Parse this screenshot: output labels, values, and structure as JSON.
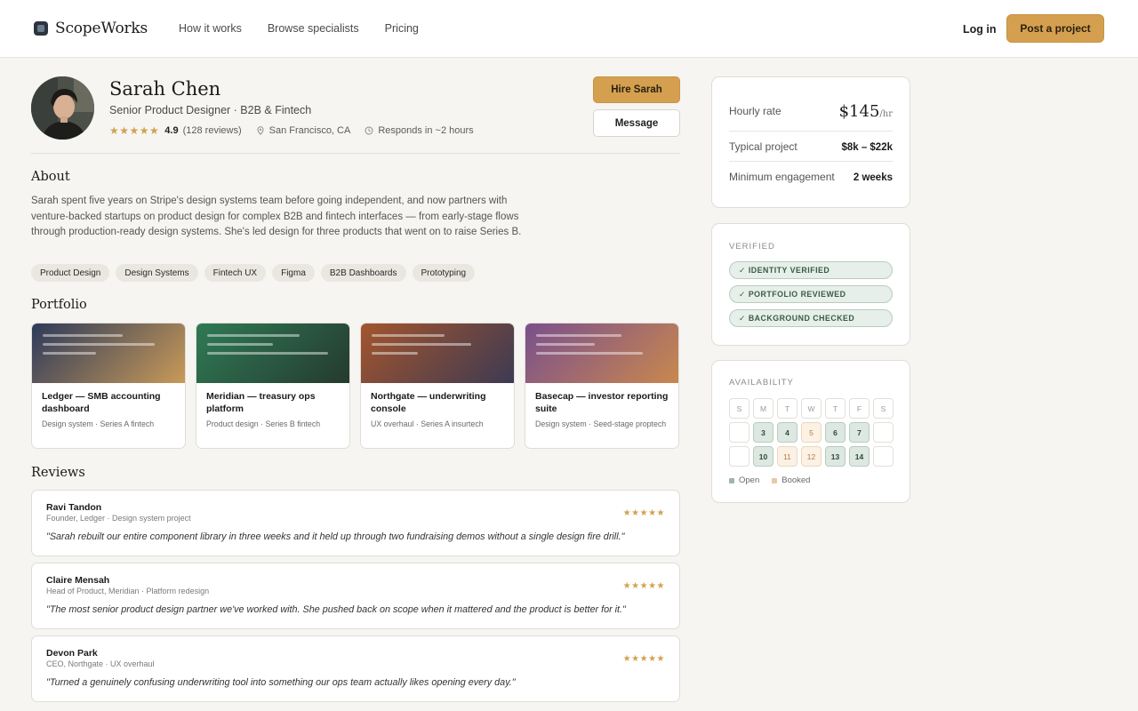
{
  "header": {
    "brand": "ScopeWorks",
    "nav": [
      "How it works",
      "Browse specialists",
      "Pricing"
    ],
    "login": "Log in",
    "post_project": "Post a project"
  },
  "profile": {
    "name": "Sarah Chen",
    "title": "Senior Product Designer · B2B & Fintech",
    "stars": "★★★★★",
    "rating": "4.9",
    "reviews_count": "(128 reviews)",
    "location": "San Francisco, CA",
    "response": "Responds in ~2 hours",
    "hire_label": "Hire Sarah",
    "message_label": "Message"
  },
  "about": {
    "heading": "About",
    "text": "Sarah spent five years on Stripe's design systems team before going independent, and now partners with venture-backed startups on product design for complex B2B and fintech interfaces — from early-stage flows through production-ready design systems. She's led design for three products that went on to raise Series B.",
    "tags": [
      "Product Design",
      "Design Systems",
      "Fintech UX",
      "Figma",
      "B2B Dashboards",
      "Prototyping"
    ]
  },
  "portfolio": {
    "heading": "Portfolio",
    "items": [
      {
        "title": "Ledger — SMB accounting dashboard",
        "subtitle": "Design system · Series A fintech",
        "color_a": "#2d3a5a",
        "color_b": "#c99a58"
      },
      {
        "title": "Meridian — treasury ops platform",
        "subtitle": "Product design · Series B fintech",
        "color_a": "#2f7a55",
        "color_b": "#253a2e"
      },
      {
        "title": "Northgate — underwriting console",
        "subtitle": "UX overhaul · Series A insurtech",
        "color_a": "#a3552e",
        "color_b": "#3d3a52"
      },
      {
        "title": "Basecap — investor reporting suite",
        "subtitle": "Design system · Seed-stage proptech",
        "color_a": "#7a4f8c",
        "color_b": "#c9884e"
      }
    ]
  },
  "reviews": {
    "heading": "Reviews",
    "items": [
      {
        "name": "Ravi Tandon",
        "role": "Founder, Ledger · Design system project",
        "stars": "★★★★★",
        "quote": "\"Sarah rebuilt our entire component library in three weeks and it held up through two fundraising demos without a single design fire drill.\""
      },
      {
        "name": "Claire Mensah",
        "role": "Head of Product, Meridian · Platform redesign",
        "stars": "★★★★★",
        "quote": "\"The most senior product design partner we've worked with. She pushed back on scope when it mattered and the product is better for it.\""
      },
      {
        "name": "Devon Park",
        "role": "CEO, Northgate · UX overhaul",
        "stars": "★★★★★",
        "quote": "\"Turned a genuinely confusing underwriting tool into something our ops team actually likes opening every day.\""
      }
    ]
  },
  "rates": {
    "hourly_label": "Hourly rate",
    "hourly_value": "$145",
    "hourly_unit": "/hr",
    "typical_label": "Typical project",
    "typical_value": "$8k – $22k",
    "min_label": "Minimum engagement",
    "min_value": "2 weeks"
  },
  "verified": {
    "label": "VERIFIED",
    "badges": [
      "✓ IDENTITY VERIFIED",
      "✓ PORTFOLIO REVIEWED",
      "✓ BACKGROUND CHECKED"
    ]
  },
  "availability": {
    "label": "AVAILABILITY",
    "days": [
      "S",
      "M",
      "T",
      "W",
      "T",
      "F",
      "S"
    ],
    "weeks": [
      [
        {
          "d": "",
          "s": "empty"
        },
        {
          "d": "3",
          "s": "open"
        },
        {
          "d": "4",
          "s": "open"
        },
        {
          "d": "5",
          "s": "booked"
        },
        {
          "d": "6",
          "s": "open"
        },
        {
          "d": "7",
          "s": "open"
        },
        {
          "d": "",
          "s": "empty"
        }
      ],
      [
        {
          "d": "",
          "s": "empty"
        },
        {
          "d": "10",
          "s": "open"
        },
        {
          "d": "11",
          "s": "booked"
        },
        {
          "d": "12",
          "s": "booked"
        },
        {
          "d": "13",
          "s": "open"
        },
        {
          "d": "14",
          "s": "open"
        },
        {
          "d": "",
          "s": "empty"
        }
      ]
    ],
    "legend_open": "Open",
    "legend_booked": "Booked",
    "open_color": "#9fb5a8",
    "booked_color": "#e8c9a4"
  },
  "colors": {
    "accent": "#d4a04f"
  }
}
